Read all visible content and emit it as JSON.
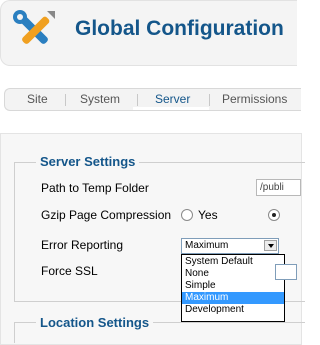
{
  "header": {
    "title": "Global Configuration",
    "icon": "tools-icon"
  },
  "tabs": [
    {
      "label": "Site",
      "active": false
    },
    {
      "label": "System",
      "active": false
    },
    {
      "label": "Server",
      "active": true
    },
    {
      "label": "Permissions",
      "active": false
    }
  ],
  "server_settings": {
    "legend": "Server Settings",
    "temp_folder": {
      "label": "Path to Temp Folder",
      "value": "/publi"
    },
    "gzip": {
      "label": "Gzip Page Compression",
      "yes_label": "Yes",
      "selected": "No"
    },
    "error_reporting": {
      "label": "Error Reporting",
      "value": "Maximum",
      "options": [
        "System Default",
        "None",
        "Simple",
        "Maximum",
        "Development"
      ]
    },
    "force_ssl": {
      "label": "Force SSL"
    }
  },
  "location_settings": {
    "legend": "Location Settings"
  },
  "colors": {
    "accent": "#14568a",
    "selection": "#3399ff"
  }
}
